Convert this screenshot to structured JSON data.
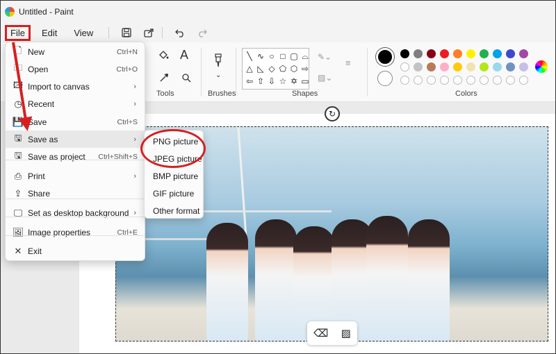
{
  "window": {
    "title": "Untitled - Paint"
  },
  "menubar": {
    "file": "File",
    "edit": "Edit",
    "view": "View"
  },
  "ribbon": {
    "tools_label": "Tools",
    "brushes_label": "Brushes",
    "shapes_label": "Shapes",
    "colors_label": "Colors"
  },
  "palette_row1": [
    "#000000",
    "#7f7f7f",
    "#880015",
    "#ed1c24",
    "#ff7f27",
    "#fff200",
    "#22b14c",
    "#00a2e8",
    "#3f48cc",
    "#a349a4"
  ],
  "palette_row2": [
    "#ffffff",
    "#c3c3c3",
    "#b97a57",
    "#ffaec9",
    "#ffc90e",
    "#efe4b0",
    "#b5e61d",
    "#99d9ea",
    "#7092be",
    "#c8bfe7"
  ],
  "file_menu": {
    "items": [
      {
        "label": "New",
        "shortcut": "Ctrl+N",
        "icon": "new-file-icon"
      },
      {
        "label": "Open",
        "shortcut": "Ctrl+O",
        "icon": "folder-icon"
      },
      {
        "label": "Import to canvas",
        "shortcut": "",
        "icon": "image-import-icon"
      },
      {
        "label": "Recent",
        "shortcut": "",
        "icon": "clock-icon"
      },
      {
        "label": "Save",
        "shortcut": "Ctrl+S",
        "icon": "save-icon"
      },
      {
        "label": "Save as",
        "shortcut": "",
        "icon": "save-as-icon"
      },
      {
        "label": "Save as project",
        "shortcut": "Ctrl+Shift+S",
        "icon": "save-project-icon"
      },
      {
        "label": "Print",
        "shortcut": "",
        "icon": "print-icon"
      },
      {
        "label": "Share",
        "shortcut": "",
        "icon": "share-icon"
      },
      {
        "label": "Set as desktop background",
        "shortcut": "",
        "icon": "desktop-icon"
      },
      {
        "label": "Image properties",
        "shortcut": "Ctrl+E",
        "icon": "image-properties-icon"
      },
      {
        "label": "Exit",
        "shortcut": "",
        "icon": "close-icon"
      }
    ]
  },
  "save_as_submenu": [
    "PNG picture",
    "JPEG picture",
    "BMP picture",
    "GIF picture",
    "Other format"
  ],
  "annotation_color": "#d62020"
}
